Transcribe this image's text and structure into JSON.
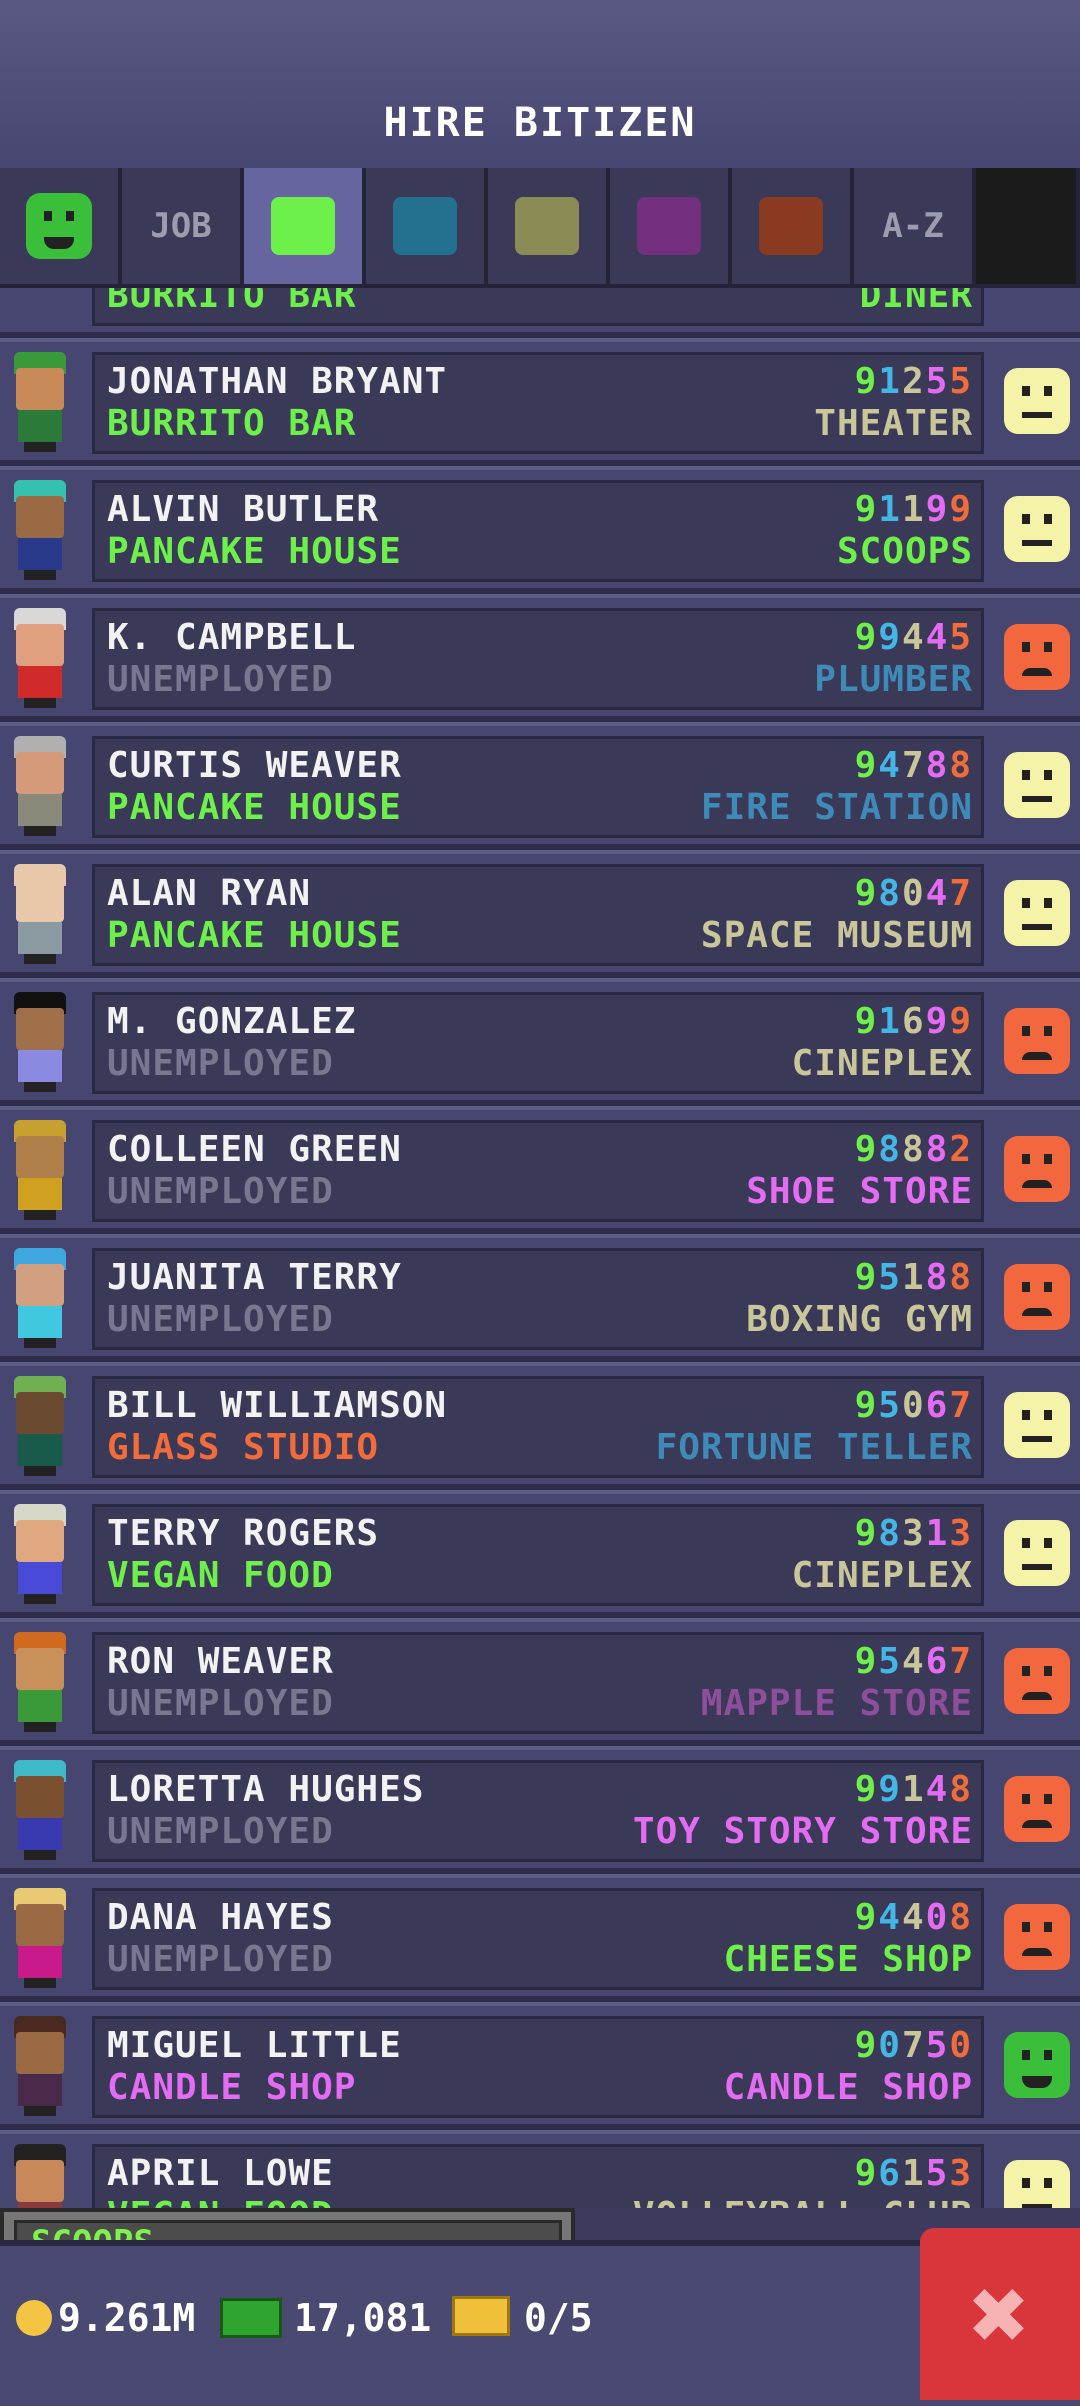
{
  "header": {
    "title": "HIRE BITIZEN"
  },
  "tabs": [
    {
      "id": "mood",
      "label": "",
      "icon": "happy-face-icon",
      "color": "#3bbf3b"
    },
    {
      "id": "job",
      "label": "JOB"
    },
    {
      "id": "food",
      "label": "",
      "color": "#6ef04a",
      "active": true
    },
    {
      "id": "service",
      "label": "",
      "color": "#23708f"
    },
    {
      "id": "recreation",
      "label": "",
      "color": "#8b8b55"
    },
    {
      "id": "retail",
      "label": "",
      "color": "#73307f"
    },
    {
      "id": "creative",
      "label": "",
      "color": "#8a3a20"
    },
    {
      "id": "az",
      "label": "A-Z"
    }
  ],
  "list": {
    "partial_top": {
      "job": "BURRITO BAR",
      "dream": "DINER"
    },
    "rows": [
      {
        "name": "JONATHAN BRYANT",
        "job": "BURRITO BAR",
        "job_color": "#6ef04a",
        "skills": [
          "9",
          "1",
          "2",
          "5",
          "5"
        ],
        "dream": "THEATER",
        "dream_color": "#c9c79a",
        "mood": "neutral"
      },
      {
        "name": "ALVIN BUTLER",
        "job": "PANCAKE HOUSE",
        "job_color": "#6ef04a",
        "skills": [
          "9",
          "1",
          "1",
          "9",
          "9"
        ],
        "dream": "SCOOPS",
        "dream_color": "#6ef04a",
        "mood": "neutral"
      },
      {
        "name": "K. CAMPBELL",
        "job": "UNEMPLOYED",
        "job_color": "#77778f",
        "skills": [
          "9",
          "9",
          "4",
          "4",
          "5"
        ],
        "dream": "PLUMBER",
        "dream_color": "#3e8ab8",
        "mood": "sad"
      },
      {
        "name": "CURTIS WEAVER",
        "job": "PANCAKE HOUSE",
        "job_color": "#6ef04a",
        "skills": [
          "9",
          "4",
          "7",
          "8",
          "8"
        ],
        "dream": "FIRE STATION",
        "dream_color": "#3e8ab8",
        "mood": "neutral"
      },
      {
        "name": "ALAN RYAN",
        "job": "PANCAKE HOUSE",
        "job_color": "#6ef04a",
        "skills": [
          "9",
          "8",
          "0",
          "4",
          "7"
        ],
        "dream": "SPACE MUSEUM",
        "dream_color": "#c9c79a",
        "mood": "neutral"
      },
      {
        "name": "M. GONZALEZ",
        "job": "UNEMPLOYED",
        "job_color": "#77778f",
        "skills": [
          "9",
          "1",
          "6",
          "9",
          "9"
        ],
        "dream": "CINEPLEX",
        "dream_color": "#c9c79a",
        "mood": "sad"
      },
      {
        "name": "COLLEEN GREEN",
        "job": "UNEMPLOYED",
        "job_color": "#77778f",
        "skills": [
          "9",
          "8",
          "8",
          "8",
          "2"
        ],
        "dream": "SHOE STORE",
        "dream_color": "#e46cf2",
        "mood": "sad"
      },
      {
        "name": "JUANITA TERRY",
        "job": "UNEMPLOYED",
        "job_color": "#77778f",
        "skills": [
          "9",
          "5",
          "1",
          "8",
          "8"
        ],
        "dream": "BOXING GYM",
        "dream_color": "#c9c79a",
        "mood": "sad"
      },
      {
        "name": "BILL WILLIAMSON",
        "job": "GLASS STUDIO",
        "job_color": "#f26b3a",
        "skills": [
          "9",
          "5",
          "0",
          "6",
          "7"
        ],
        "dream": "FORTUNE TELLER",
        "dream_color": "#3e8ab8",
        "mood": "neutral"
      },
      {
        "name": "TERRY ROGERS",
        "job": "VEGAN FOOD",
        "job_color": "#6ef04a",
        "skills": [
          "9",
          "8",
          "3",
          "1",
          "3"
        ],
        "dream": "CINEPLEX",
        "dream_color": "#c9c79a",
        "mood": "neutral"
      },
      {
        "name": "RON WEAVER",
        "job": "UNEMPLOYED",
        "job_color": "#77778f",
        "skills": [
          "9",
          "5",
          "4",
          "6",
          "7"
        ],
        "dream": "MAPPLE STORE",
        "dream_color": "#8e4e9c",
        "mood": "sad"
      },
      {
        "name": "LORETTA HUGHES",
        "job": "UNEMPLOYED",
        "job_color": "#77778f",
        "skills": [
          "9",
          "9",
          "1",
          "4",
          "8"
        ],
        "dream": "TOY STORY STORE",
        "dream_color": "#e46cf2",
        "mood": "sad"
      },
      {
        "name": "DANA HAYES",
        "job": "UNEMPLOYED",
        "job_color": "#77778f",
        "skills": [
          "9",
          "4",
          "4",
          "0",
          "8"
        ],
        "dream": "CHEESE SHOP",
        "dream_color": "#6ef04a",
        "mood": "sad"
      },
      {
        "name": "MIGUEL LITTLE",
        "job": "CANDLE SHOP",
        "job_color": "#e46cf2",
        "skills": [
          "9",
          "0",
          "7",
          "5",
          "0"
        ],
        "dream": "CANDLE SHOP",
        "dream_color": "#e46cf2",
        "mood": "happy"
      },
      {
        "name": "APRIL LOWE",
        "job": "VEGAN FOOD",
        "job_color": "#6ef04a",
        "skills": [
          "9",
          "6",
          "1",
          "5",
          "3"
        ],
        "dream": "VOLLEYBALL CLUB",
        "dream_color": "#c9c79a",
        "mood": "neutral"
      }
    ]
  },
  "skill_colors": [
    "#6ef04a",
    "#44b6e6",
    "#c9c79a",
    "#e46cf2",
    "#f26b3a"
  ],
  "mood_colors": {
    "neutral": "#f4f3a8",
    "sad": "#f2673e",
    "happy": "#3bbf3b"
  },
  "footer": {
    "selected_business": "SCOOPS",
    "coins": "9.261M",
    "bux": "17,081",
    "tickets": "0/5"
  }
}
